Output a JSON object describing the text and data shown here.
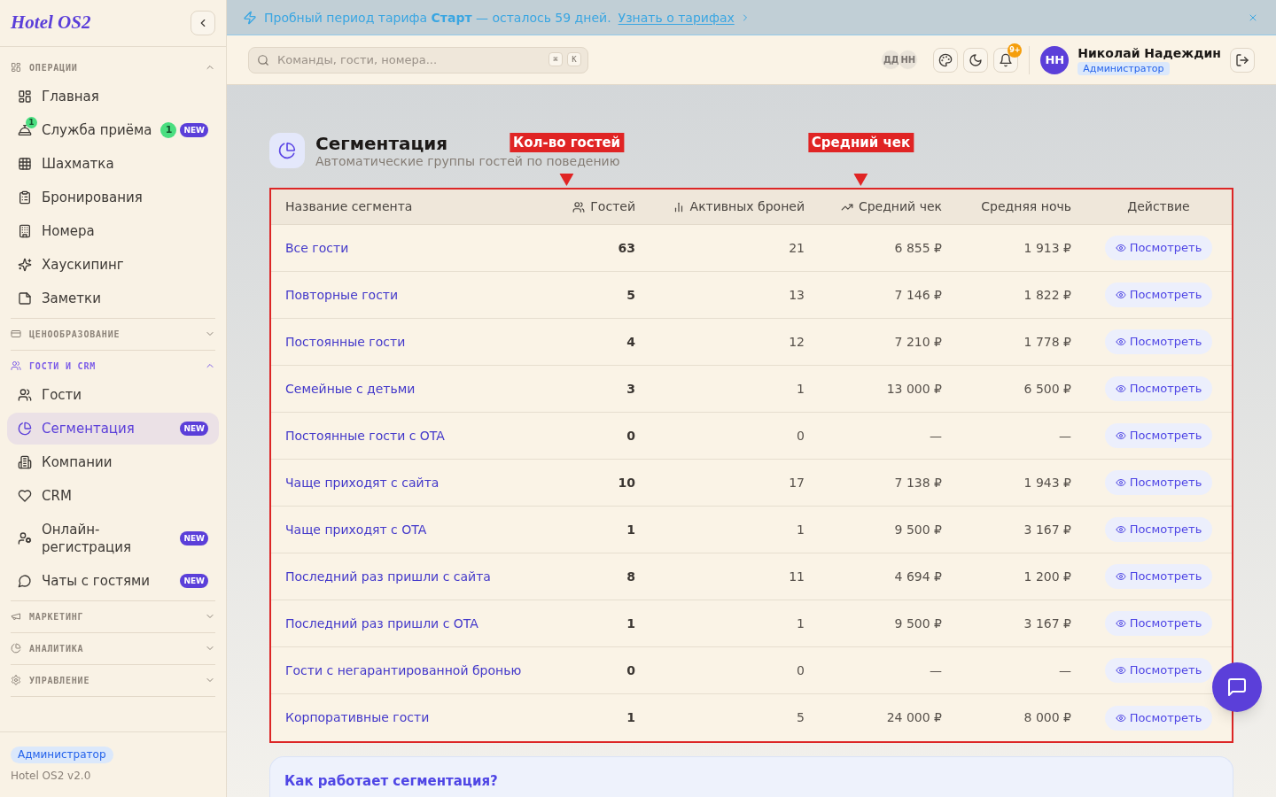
{
  "sidebar": {
    "logo": "Hotel OS2",
    "sections": [
      {
        "label": "ОПЕРАЦИИ",
        "expanded": true,
        "active": false,
        "items": [
          {
            "label": "Главная",
            "selected": false
          },
          {
            "label": "Служба приёма",
            "selected": false,
            "icon_badge": "1",
            "count": "1",
            "badge": "NEW"
          },
          {
            "label": "Шахматка",
            "selected": false
          },
          {
            "label": "Бронирования",
            "selected": false
          },
          {
            "label": "Номера",
            "selected": false
          },
          {
            "label": "Хаускипинг",
            "selected": false
          },
          {
            "label": "Заметки",
            "selected": false
          }
        ]
      },
      {
        "label": "ЦЕНООБРАЗОВАНИЕ",
        "expanded": false,
        "active": false
      },
      {
        "label": "ГОСТИ И CRM",
        "expanded": true,
        "active": true,
        "items": [
          {
            "label": "Гости",
            "selected": false
          },
          {
            "label": "Сегментация",
            "selected": true,
            "badge": "NEW"
          },
          {
            "label": "Компании",
            "selected": false
          },
          {
            "label": "CRM",
            "selected": false
          },
          {
            "label": "Онлайн-регистрация",
            "selected": false,
            "badge": "NEW"
          },
          {
            "label": "Чаты с гостями",
            "selected": false,
            "badge": "NEW"
          }
        ]
      },
      {
        "label": "МАРКЕТИНГ",
        "expanded": false,
        "active": false
      },
      {
        "label": "АНАЛИТИКА",
        "expanded": false,
        "active": false
      },
      {
        "label": "УПРАВЛЕНИЕ",
        "expanded": false,
        "active": false
      }
    ],
    "footer": {
      "role": "Администратор",
      "version": "Hotel OS2 v2.0"
    }
  },
  "banner": {
    "text": "Пробный период тарифа **Старт** — осталось 59 дней.",
    "link": "Узнать о тарифах"
  },
  "header": {
    "search": {
      "placeholder": "Команды, гости, номера...",
      "shortcut": [
        "⌘",
        "K"
      ]
    },
    "online_users": [
      "ДД",
      "НН"
    ],
    "notifications": "9+",
    "user": {
      "initials": "НН",
      "name": "Николай Надеждин",
      "role": "Администратор"
    }
  },
  "page": {
    "title": "Сегментация",
    "subtitle": "Автоматические группы гостей по поведению"
  },
  "table": {
    "highlighted": true,
    "columns": [
      {
        "label": "Название сегмента"
      },
      {
        "label": "Гостей",
        "annotation": "Кол-во гостей"
      },
      {
        "label": "Активных броней"
      },
      {
        "label": "Средний чек",
        "annotation": "Средний чек"
      },
      {
        "label": "Средняя ночь"
      },
      {
        "label": "Действие"
      }
    ],
    "rows": [
      {
        "name": "Все гости",
        "guests": "63",
        "active_bookings": "21",
        "avg_check": "6 855 ₽",
        "avg_night": "1 913 ₽",
        "action": "Посмотреть"
      },
      {
        "name": "Повторные гости",
        "guests": "5",
        "active_bookings": "13",
        "avg_check": "7 146 ₽",
        "avg_night": "1 822 ₽",
        "action": "Посмотреть"
      },
      {
        "name": "Постоянные гости",
        "guests": "4",
        "active_bookings": "12",
        "avg_check": "7 210 ₽",
        "avg_night": "1 778 ₽",
        "action": "Посмотреть"
      },
      {
        "name": "Семейные с детьми",
        "guests": "3",
        "active_bookings": "1",
        "avg_check": "13 000 ₽",
        "avg_night": "6 500 ₽",
        "action": "Посмотреть"
      },
      {
        "name": "Постоянные гости с OTA",
        "guests": "0",
        "active_bookings": "0",
        "avg_check": "—",
        "avg_night": "—",
        "action": "Посмотреть"
      },
      {
        "name": "Чаще приходят с сайта",
        "guests": "10",
        "active_bookings": "17",
        "avg_check": "7 138 ₽",
        "avg_night": "1 943 ₽",
        "action": "Посмотреть"
      },
      {
        "name": "Чаще приходят с OTA",
        "guests": "1",
        "active_bookings": "1",
        "avg_check": "9 500 ₽",
        "avg_night": "3 167 ₽",
        "action": "Посмотреть"
      },
      {
        "name": "Последний раз пришли с сайта",
        "guests": "8",
        "active_bookings": "11",
        "avg_check": "4 694 ₽",
        "avg_night": "1 200 ₽",
        "action": "Посмотреть"
      },
      {
        "name": "Последний раз пришли с OTA",
        "guests": "1",
        "active_bookings": "1",
        "avg_check": "9 500 ₽",
        "avg_night": "3 167 ₽",
        "action": "Посмотреть"
      },
      {
        "name": "Гости с негарантированной бронью",
        "guests": "0",
        "active_bookings": "0",
        "avg_check": "—",
        "avg_night": "—",
        "action": "Посмотреть"
      },
      {
        "name": "Корпоративные гости",
        "guests": "1",
        "active_bookings": "5",
        "avg_check": "24 000 ₽",
        "avg_night": "8 000 ₽",
        "action": "Посмотреть"
      }
    ]
  },
  "info_card": {
    "title": "Как работает сегментация?"
  }
}
